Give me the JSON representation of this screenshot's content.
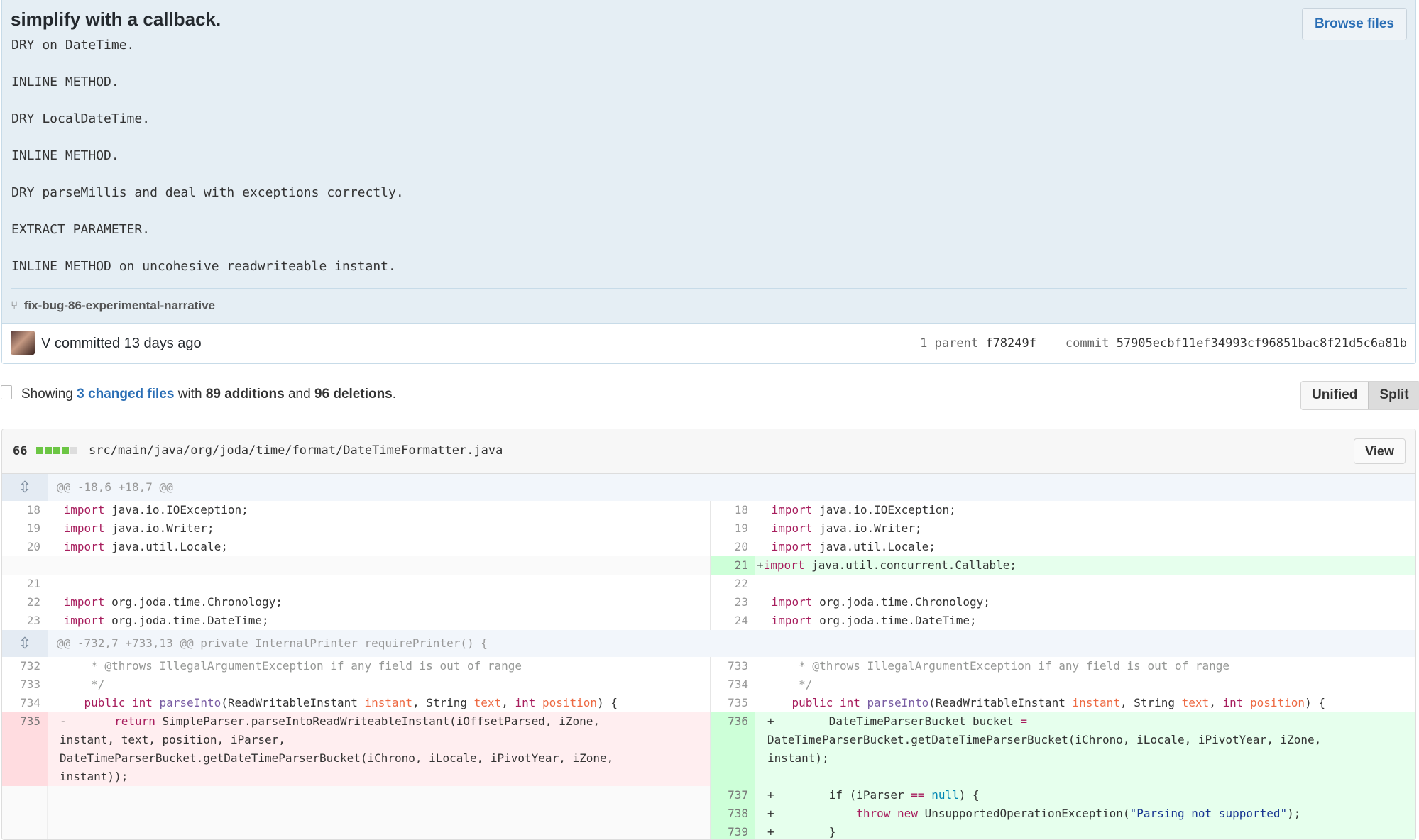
{
  "commit": {
    "title": "simplify with a callback.",
    "browse_files_label": "Browse files",
    "description_lines": [
      "DRY on DateTime.",
      "INLINE METHOD.",
      "DRY LocalDateTime.",
      "INLINE METHOD.",
      "DRY parseMillis and deal with exceptions correctly.",
      "EXTRACT PARAMETER.",
      "INLINE METHOD on uncohesive readwriteable instant."
    ],
    "branch": "fix-bug-86-experimental-narrative",
    "author_line": "V committed 13 days ago",
    "parent_label": "1 parent",
    "parent_sha": "f78249f",
    "commit_label": "commit",
    "commit_sha": "57905ecbf11ef34993cf96851bac8f21d5c6a81b"
  },
  "summary": {
    "showing": "Showing",
    "changed_files": "3 changed files",
    "with": "with",
    "additions": "89 additions",
    "and": "and",
    "deletions": "96 deletions",
    "period": "."
  },
  "view_toggle": {
    "unified": "Unified",
    "split": "Split",
    "selected": "Split"
  },
  "file": {
    "change_count": "66",
    "path": "src/main/java/org/joda/time/format/DateTimeFormatter.java",
    "view_label": "View",
    "hunk1_header": "@@ -18,6 +18,7 @@",
    "hunk2_header": "@@ -732,7 +733,13 @@ private InternalPrinter requirePrinter() {",
    "line_numbers": {
      "l18": "18",
      "l19": "19",
      "l20": "20",
      "l21": "21",
      "l22": "22",
      "l23": "23",
      "l24": "24",
      "l732": "732",
      "l733": "733",
      "l734": "734",
      "l735": "735",
      "l736": "736",
      "l737": "737",
      "l738": "738",
      "l739": "739"
    },
    "code": {
      "ioexception": "java.io.IOException;",
      "writer": "java.io.Writer;",
      "locale": "java.util.Locale;",
      "callable": "java.util.concurrent.Callable;",
      "chronology": "org.joda.time.Chronology;",
      "datetime": "org.joda.time.DateTime;",
      "import_kw": "import",
      "throws_comment": "     * @throws IllegalArgumentException if any field is out of range",
      "close_comment": "     */",
      "public": "public",
      "int": "int",
      "parseInto": "parseInto",
      "readwritable": "(ReadWritableInstant ",
      "instant": "instant",
      "string": ", String ",
      "text": "text",
      "comma": ", ",
      "position": "position",
      "sig_end": ") {",
      "return": "return",
      "del_line_1": " SimpleParser.parseIntoReadWriteableInstant(iOffsetParsed, iZone,",
      "del_line_2": "instant, text, position, iParser,",
      "del_line_3": "DateTimeParserBucket.getDateTimeParserBucket(iChrono, iLocale, iPivotYear, iZone,",
      "del_line_4": "instant));",
      "add_line_1": "        DateTimeParserBucket bucket ",
      "eq": "=",
      "add_line_2": "DateTimeParserBucket.getDateTimeParserBucket(iChrono, iLocale, iPivotYear, iZone,",
      "add_line_3": "instant);",
      "if_pre": "        if (iParser ",
      "eqeq": "==",
      "null": "null",
      "if_post": ") {",
      "throw": "throw",
      "new": "new",
      "unsupported": " UnsupportedOperationException(",
      "parsing_str": "\"Parsing not supported\"",
      "throw_end": ");",
      "close_brace": "        }"
    }
  }
}
